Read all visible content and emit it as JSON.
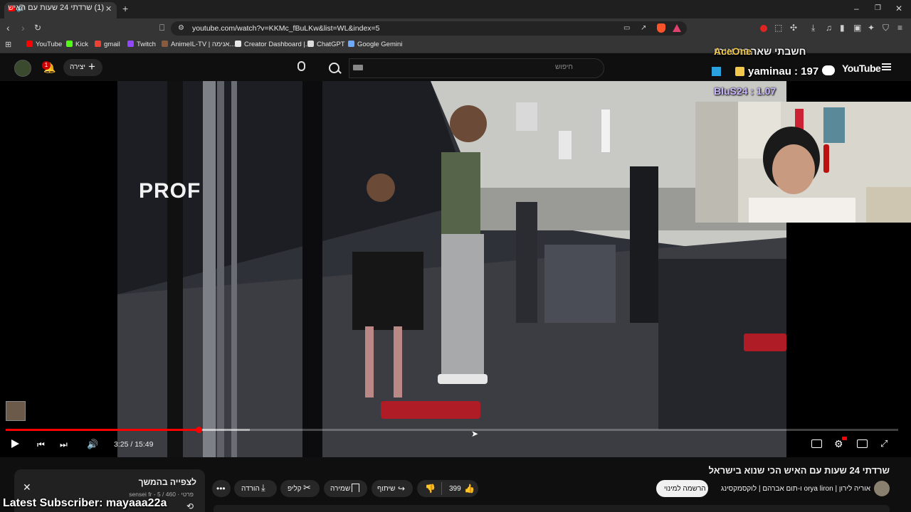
{
  "browser": {
    "tab_title": "(1) שרדתי 24 שעות עם האיש",
    "url": "youtube.com/watch?v=KKMc_fBuLKw&list=WL&index=5",
    "bookmarks": [
      {
        "label": "YouTube",
        "color": "#ff0000"
      },
      {
        "label": "Kick",
        "color": "#53fc18"
      },
      {
        "label": "gmail",
        "color": "#ea4335"
      },
      {
        "label": "Twitch",
        "color": "#9146ff"
      },
      {
        "label": "AnimeIL-TV | אנימה...",
        "color": "#8a5a3c"
      },
      {
        "label": "Creator Dashboard |...",
        "color": "#e8e8e8"
      },
      {
        "label": "ChatGPT",
        "color": "#dddddd"
      },
      {
        "label": "Google Gemini",
        "color": "#6fa8ff"
      }
    ]
  },
  "yt": {
    "create_label": "יצירה",
    "search_placeholder": "חיפוש",
    "logo_text": "YouTube",
    "notif_count": "1",
    "time": "3:25 / 15:49",
    "progress_fraction": 0.216,
    "video_title": "שרדתי 24 שעות עם האיש הכי שנוא בישראל",
    "channel": "אוריה לירון | orya liron ו-תום אברהם | לוקסמקסינג",
    "subscribe_label": "הרשמה למינוי",
    "like_count": "399",
    "share_label": "שיתוף",
    "save_label": "שמירה",
    "clip_label": "קליפ",
    "download_label": "הורדה",
    "panel_title": "לצפייה בהמשך",
    "panel_sub": "פרטי · sensei fr - 5 / 460"
  },
  "video_sign": "PROF",
  "stream_overlay": {
    "top_text": "חשבתי שאהבת אותו",
    "top_user": "AceOne",
    "leader1": "yaminau : 197",
    "leader2": "BluS24 : 1.07",
    "latest_sub": "Latest Subscriber: mayaaa22a"
  },
  "colors": {
    "accent": "#ff0000",
    "overlay_gold": "#f2c94c",
    "overlay_purple": "#c9b6ff"
  }
}
